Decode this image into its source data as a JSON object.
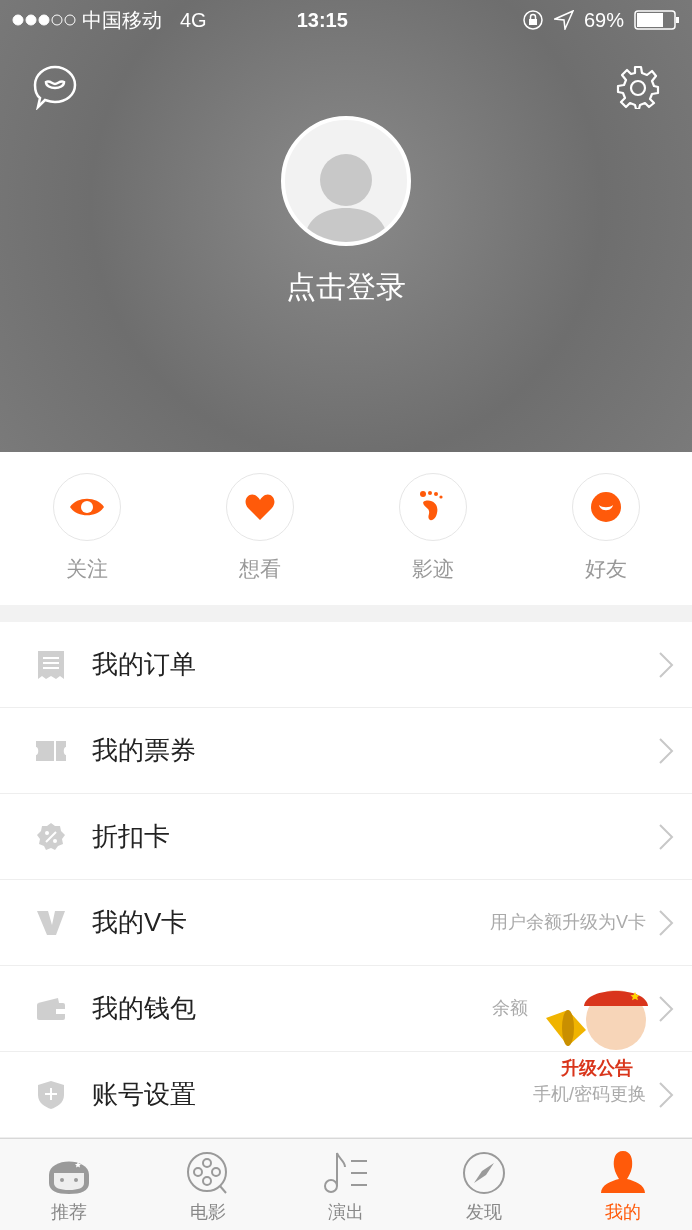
{
  "status_bar": {
    "carrier": "中国移动",
    "network": "4G",
    "time": "13:15",
    "battery": "69%"
  },
  "profile": {
    "login": "点击登录"
  },
  "shortcuts": [
    {
      "kind": "eye",
      "label": "关注"
    },
    {
      "kind": "heart",
      "label": "想看"
    },
    {
      "kind": "foot",
      "label": "影迹"
    },
    {
      "kind": "smile",
      "label": "好友"
    }
  ],
  "menu": [
    {
      "kind": "order",
      "label": "我的订单"
    },
    {
      "kind": "ticket",
      "label": "我的票券"
    },
    {
      "kind": "discount",
      "label": "折扣卡"
    },
    {
      "kind": "vcard",
      "label": "我的V卡",
      "hint": "用户余额升级为V卡"
    },
    {
      "kind": "wallet",
      "label": "我的钱包",
      "hint": "余额"
    },
    {
      "kind": "account",
      "label": "账号设置",
      "hint": "手机/密码更换"
    }
  ],
  "announcement": {
    "label": "升级公告"
  },
  "tabs": [
    {
      "kind": "recommend",
      "label": "推荐",
      "selected": false
    },
    {
      "kind": "movie",
      "label": "电影",
      "selected": false
    },
    {
      "kind": "show",
      "label": "演出",
      "selected": false
    },
    {
      "kind": "discover",
      "label": "发现",
      "selected": false
    },
    {
      "kind": "me",
      "label": "我的",
      "selected": true
    }
  ]
}
